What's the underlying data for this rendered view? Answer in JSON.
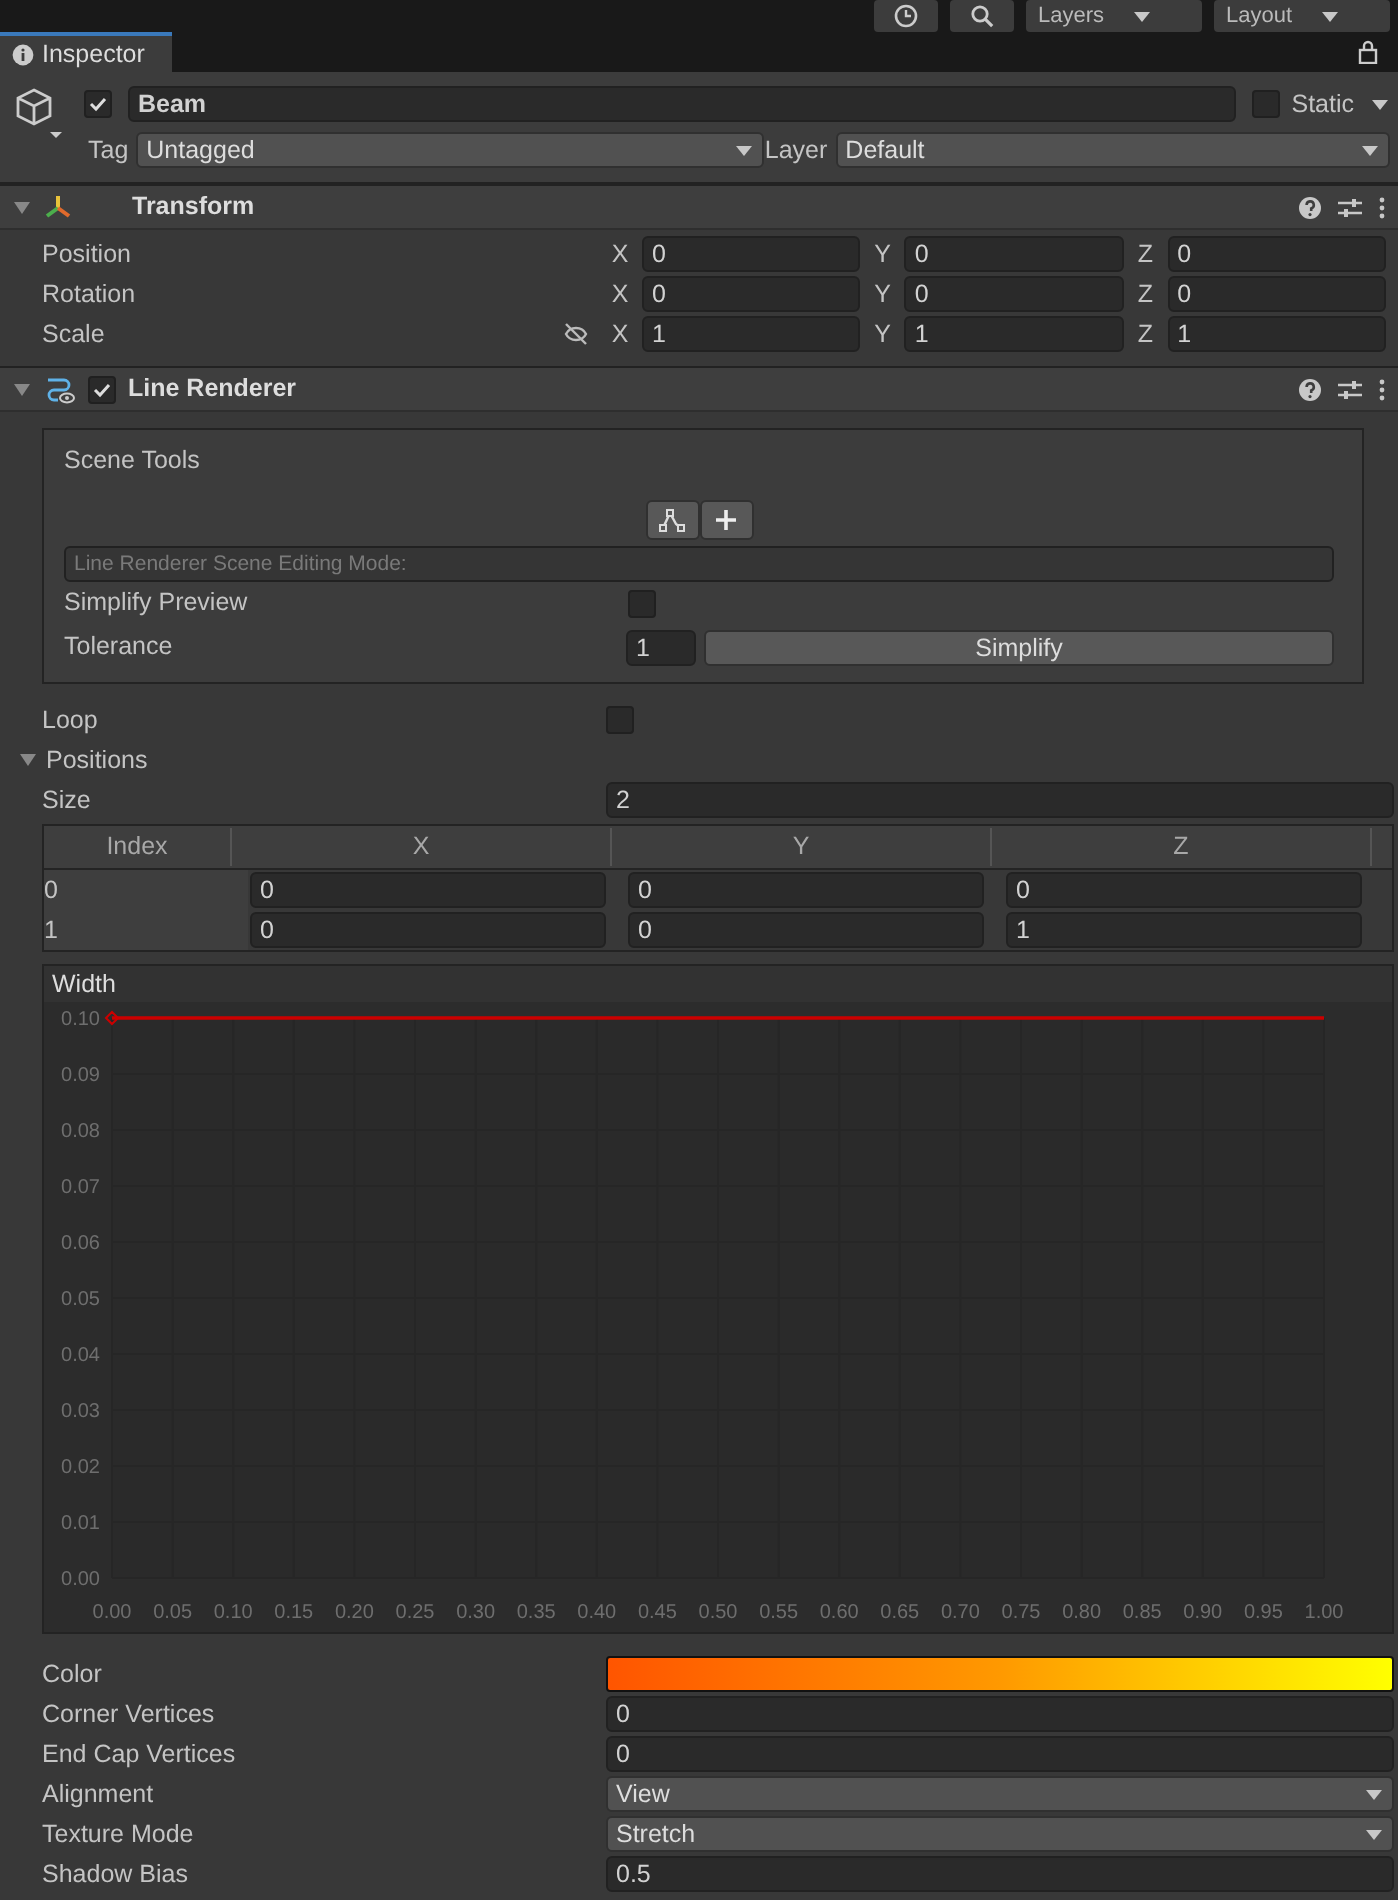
{
  "toolbar": {
    "dropdowns": [
      "Layers",
      "Layout"
    ]
  },
  "tab": {
    "label": "Inspector",
    "selected": true
  },
  "object": {
    "active": true,
    "name": "Beam",
    "static_label": "Static",
    "static": false,
    "tag_label": "Tag",
    "tag": "Untagged",
    "layer_label": "Layer",
    "layer": "Default"
  },
  "transform": {
    "title": "Transform",
    "expanded": true,
    "rows": [
      {
        "label": "Position",
        "linked": false,
        "values": [
          {
            "axis": "X",
            "value": "0"
          },
          {
            "axis": "Y",
            "value": "0"
          },
          {
            "axis": "Z",
            "value": "0"
          }
        ]
      },
      {
        "label": "Rotation",
        "linked": false,
        "values": [
          {
            "axis": "X",
            "value": "0"
          },
          {
            "axis": "Y",
            "value": "0"
          },
          {
            "axis": "Z",
            "value": "0"
          }
        ]
      },
      {
        "label": "Scale",
        "linked": true,
        "values": [
          {
            "axis": "X",
            "value": "1"
          },
          {
            "axis": "Y",
            "value": "1"
          },
          {
            "axis": "Z",
            "value": "1"
          }
        ]
      }
    ]
  },
  "line_renderer": {
    "title": "Line Renderer",
    "enabled": true,
    "expanded": true,
    "scene_tools": {
      "title": "Scene Tools",
      "mode_label": "Line Renderer Scene Editing Mode:",
      "simplify_preview_label": "Simplify Preview",
      "simplify_preview": false,
      "tolerance_label": "Tolerance",
      "tolerance": "1",
      "simplify_button": "Simplify"
    },
    "loop_label": "Loop",
    "loop": false,
    "positions": {
      "label": "Positions",
      "expanded": true,
      "size_label": "Size",
      "size": "2",
      "columns": [
        "Index",
        "X",
        "Y",
        "Z"
      ],
      "rows": [
        [
          "0",
          "0",
          "0",
          "0"
        ],
        [
          "1",
          "0",
          "0",
          "1"
        ]
      ]
    },
    "width": {
      "label": "Width",
      "chart_data": {
        "type": "line",
        "grid": true,
        "x": [
          0,
          1
        ],
        "series": [
          {
            "color": "#cc0000",
            "values": [
              0.1,
              0.1
            ]
          }
        ],
        "xlim": [
          0,
          1
        ],
        "ylim": [
          0,
          0.1
        ],
        "xticks": [
          {
            "value": 0,
            "label": "0.00"
          },
          {
            "value": 0.05,
            "label": "0.05"
          },
          {
            "value": 0.1,
            "label": "0.10"
          },
          {
            "value": 0.15,
            "label": "0.15"
          },
          {
            "value": 0.2,
            "label": "0.20"
          },
          {
            "value": 0.25,
            "label": "0.25"
          },
          {
            "value": 0.3,
            "label": "0.30"
          },
          {
            "value": 0.35,
            "label": "0.35"
          },
          {
            "value": 0.4,
            "label": "0.40"
          },
          {
            "value": 0.45,
            "label": "0.45"
          },
          {
            "value": 0.5,
            "label": "0.50"
          },
          {
            "value": 0.55,
            "label": "0.55"
          },
          {
            "value": 0.6,
            "label": "0.60"
          },
          {
            "value": 0.65,
            "label": "0.65"
          },
          {
            "value": 0.7,
            "label": "0.70"
          },
          {
            "value": 0.75,
            "label": "0.75"
          },
          {
            "value": 0.8,
            "label": "0.80"
          },
          {
            "value": 0.85,
            "label": "0.85"
          },
          {
            "value": 0.9,
            "label": "0.90"
          },
          {
            "value": 0.95,
            "label": "0.95"
          },
          {
            "value": 1,
            "label": "1.00"
          }
        ],
        "yticks": [
          {
            "value": 0,
            "label": "0.00"
          },
          {
            "value": 0.01,
            "label": "0.01"
          },
          {
            "value": 0.02,
            "label": "0.02"
          },
          {
            "value": 0.03,
            "label": "0.03"
          },
          {
            "value": 0.04,
            "label": "0.04"
          },
          {
            "value": 0.05,
            "label": "0.05"
          },
          {
            "value": 0.06,
            "label": "0.06"
          },
          {
            "value": 0.07,
            "label": "0.07"
          },
          {
            "value": 0.08,
            "label": "0.08"
          },
          {
            "value": 0.09,
            "label": "0.09"
          },
          {
            "value": 0.1,
            "label": "0.10"
          }
        ]
      }
    },
    "properties": [
      {
        "kind": "gradient",
        "label": "Color",
        "stops": [
          {
            "color": "#ff5500"
          },
          {
            "color": "#ff9900"
          },
          {
            "color": "#ffff00"
          }
        ]
      },
      {
        "kind": "number",
        "label": "Corner Vertices",
        "value": "0"
      },
      {
        "kind": "number",
        "label": "End Cap Vertices",
        "value": "0"
      },
      {
        "kind": "dropdown",
        "label": "Alignment",
        "value": "View"
      },
      {
        "kind": "dropdown",
        "label": "Texture Mode",
        "value": "Stretch"
      },
      {
        "kind": "number",
        "label": "Shadow Bias",
        "value": "0.5"
      }
    ]
  }
}
